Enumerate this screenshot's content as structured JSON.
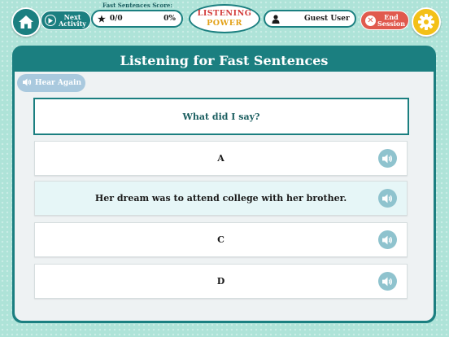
{
  "topbar": {
    "next_label_1": "Next",
    "next_label_2": "Activity",
    "score_caption": "Fast Sentences Score:",
    "score_count": "0/0",
    "score_percent": "0%",
    "logo_line_1": "LISTENING",
    "logo_line_2": "POWER",
    "user_name": "Guest User",
    "end_label_1": "End",
    "end_label_2": "Session"
  },
  "panel": {
    "title": "Listening for Fast Sentences",
    "hear_again_label": "Hear Again",
    "question": "What did I say?",
    "options": [
      {
        "text": "A",
        "selected": false
      },
      {
        "text": "Her dream was to attend college with her brother.",
        "selected": true
      },
      {
        "text": "C",
        "selected": false
      },
      {
        "text": "D",
        "selected": false
      }
    ]
  },
  "colors": {
    "background": "#aee3d8",
    "teal": "#1b7f80",
    "end_red": "#e05a4e",
    "gear_yellow": "#f3c018",
    "speaker_blue": "#8fc3ce",
    "hear_again_blue": "#a9c9de"
  },
  "icons": [
    "home-icon",
    "play-icon",
    "star-icon",
    "user-icon",
    "close-icon",
    "gear-icon",
    "speaker-icon"
  ]
}
